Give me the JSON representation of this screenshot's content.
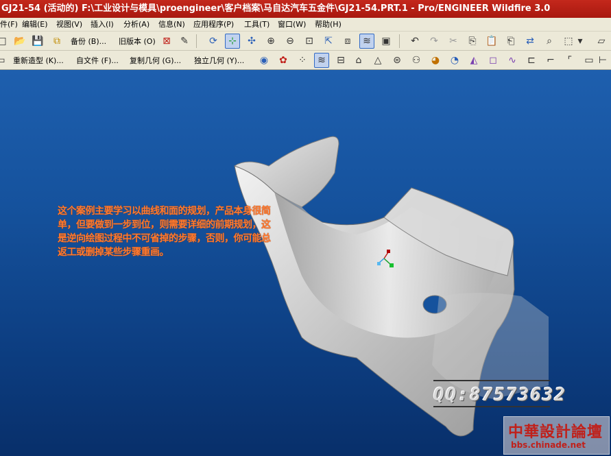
{
  "window": {
    "title": "GJ21-54 (活动的) F:\\工业设计与模具\\proengineer\\客户档案\\马自达汽车五金件\\GJ21-54.PRT.1 - Pro/ENGINEER Wildfire 3.0"
  },
  "menu": [
    {
      "label": "件(F)"
    },
    {
      "label": "编辑(E)"
    },
    {
      "label": "视图(V)"
    },
    {
      "label": "插入(I)"
    },
    {
      "label": "分析(A)"
    },
    {
      "label": "信息(N)"
    },
    {
      "label": "应用程序(P)"
    },
    {
      "label": "工具(T)"
    },
    {
      "label": "窗口(W)"
    },
    {
      "label": "帮助(H)"
    }
  ],
  "toolbar1": {
    "backup_label": "备份 (B)...",
    "old_version_label": "旧版本 (O)"
  },
  "toolbar2": {
    "restyle_label": "重新造型 (K)...",
    "from_file_label": "自文件 (F)...",
    "copy_geom_label": "复制几何 (G)...",
    "indep_geom_label": "独立几何 (Y)..."
  },
  "viewport": {
    "annotation": "这个案例主要学习以曲线和面的规划，产品本身很简单，但要做到一步到位，则需要详细的前期规划，这是逆向绘图过程中不可省掉的步骤，否则，你可能总返工或删掉某些步骤重画。",
    "watermark_qq": "QQ:87573632",
    "logo_cn": "中華設計論壇",
    "logo_en": "bbs.chinade.net"
  },
  "colors": {
    "titlebar": "#b3201a",
    "toolbar_bg": "#ece9d8",
    "viewport_top": "#1e5fae",
    "viewport_bottom": "#082f6a",
    "annotation_text": "#ff7a30",
    "logo_red": "#c0201a"
  }
}
